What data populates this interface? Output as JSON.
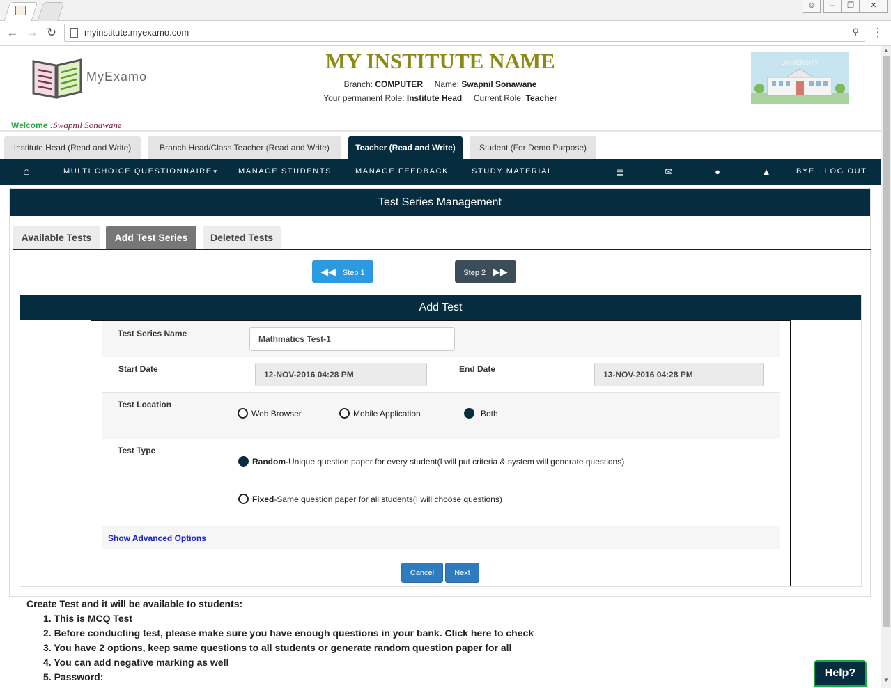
{
  "browser": {
    "url": "myinstitute.myexamo.com",
    "back_icon": "arrow-left-icon",
    "forward_icon": "arrow-right-icon",
    "reload_icon": "reload-icon"
  },
  "header": {
    "logo_text": "MyExamo",
    "institute_name": "MY INSTITUTE NAME",
    "branch_label": "Branch:",
    "branch_value": "COMPUTER",
    "name_label": "Name:",
    "name_value": "Swapnil Sonawane",
    "permanent_role_label": "Your permanent Role:",
    "permanent_role_value": "Institute Head",
    "current_role_label": "Current Role:",
    "current_role_value": "Teacher",
    "university_label": "UNIVERSITY",
    "welcome_label": "Welcome",
    "welcome_name": ":Swapnil Sonawane"
  },
  "role_tabs": [
    {
      "label": "Institute Head (Read and Write)",
      "active": false
    },
    {
      "label": "Branch Head/Class Teacher (Read and Write)",
      "active": false
    },
    {
      "label": "Teacher (Read and Write)",
      "active": true
    },
    {
      "label": "Student (For Demo Purpose)",
      "active": false
    }
  ],
  "nav": {
    "home_icon": "home-icon",
    "items": [
      "MULTI CHOICE QUESTIONNAIRE",
      "MANAGE STUDENTS",
      "MANAGE FEEDBACK",
      "STUDY MATERIAL"
    ],
    "logout": "BYE.. LOG OUT"
  },
  "panel": {
    "title": "Test Series Management",
    "tabs": [
      "Available Tests",
      "Add Test Series",
      "Deleted Tests"
    ],
    "active_tab": "Add Test Series",
    "step1": "Step 1",
    "step2": "Step 2"
  },
  "form": {
    "title": "Add Test",
    "test_series_name_label": "Test Series Name",
    "test_series_name_value": "Mathmatics Test-1",
    "start_date_label": "Start Date",
    "start_date_value": "12-NOV-2016 04:28 PM",
    "end_date_label": "End Date",
    "end_date_value": "13-NOV-2016 04:28 PM",
    "location_label": "Test Location",
    "location_options": [
      "Web Browser",
      "Mobile Application",
      "Both"
    ],
    "location_selected": "Both",
    "type_label": "Test Type",
    "type_random_bold": "Random",
    "type_random_text": "-Unique question paper for every student(I will put criteria & system will generate questions)",
    "type_fixed_bold": "Fixed",
    "type_fixed_text": "-Same question paper for all students(I will choose questions)",
    "type_selected": "Random",
    "advanced_link": "Show Advanced Options",
    "cancel": "Cancel",
    "next": "Next"
  },
  "info": {
    "title": "Create Test and it will be available to students:",
    "items": [
      "1. This is MCQ Test",
      "2. Before conducting test, please make sure you have enough questions in your bank. Click here to check",
      "3. You have 2 options, keep same questions to all students or generate random question paper for all",
      "4. You can add negative marking as well",
      "5. Password:"
    ]
  },
  "help_label": "Help?"
}
